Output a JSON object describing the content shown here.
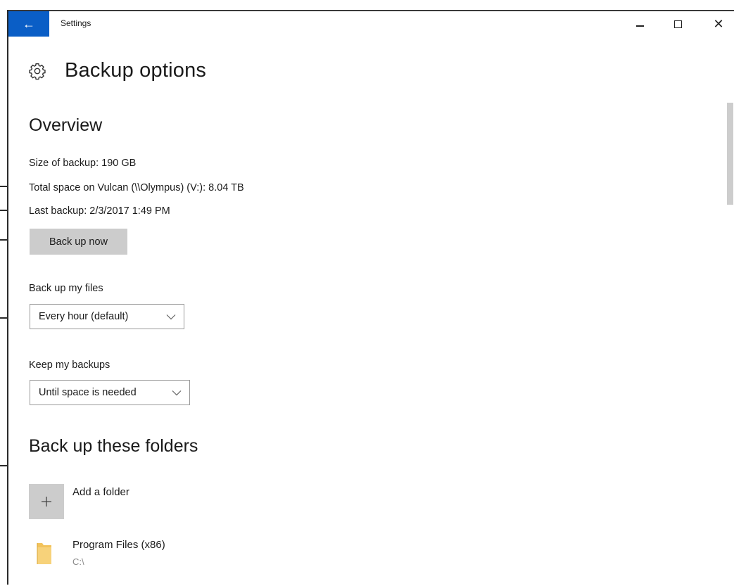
{
  "window": {
    "title": "Settings",
    "back_glyph": "←",
    "close_glyph": "✕",
    "accent_color": "#0a5ec6"
  },
  "page": {
    "title": "Backup options",
    "icon": "gear-icon"
  },
  "overview": {
    "heading": "Overview",
    "size": "Size of backup: 190 GB",
    "total_space": "Total space on Vulcan (\\\\Olympus) (V:): 8.04 TB",
    "last_backup": "Last backup: 2/3/2017 1:49 PM",
    "back_up_now": "Back up now"
  },
  "frequency": {
    "label": "Back up my files",
    "selected": "Every hour (default)"
  },
  "retention": {
    "label": "Keep my backups",
    "selected": "Until space is needed"
  },
  "folders": {
    "heading": "Back up these folders",
    "add_glyph": "+",
    "add_label": "Add a folder",
    "items": [
      {
        "name": "Program Files (x86)",
        "path": "C:\\",
        "icon": "folder-icon"
      }
    ]
  }
}
